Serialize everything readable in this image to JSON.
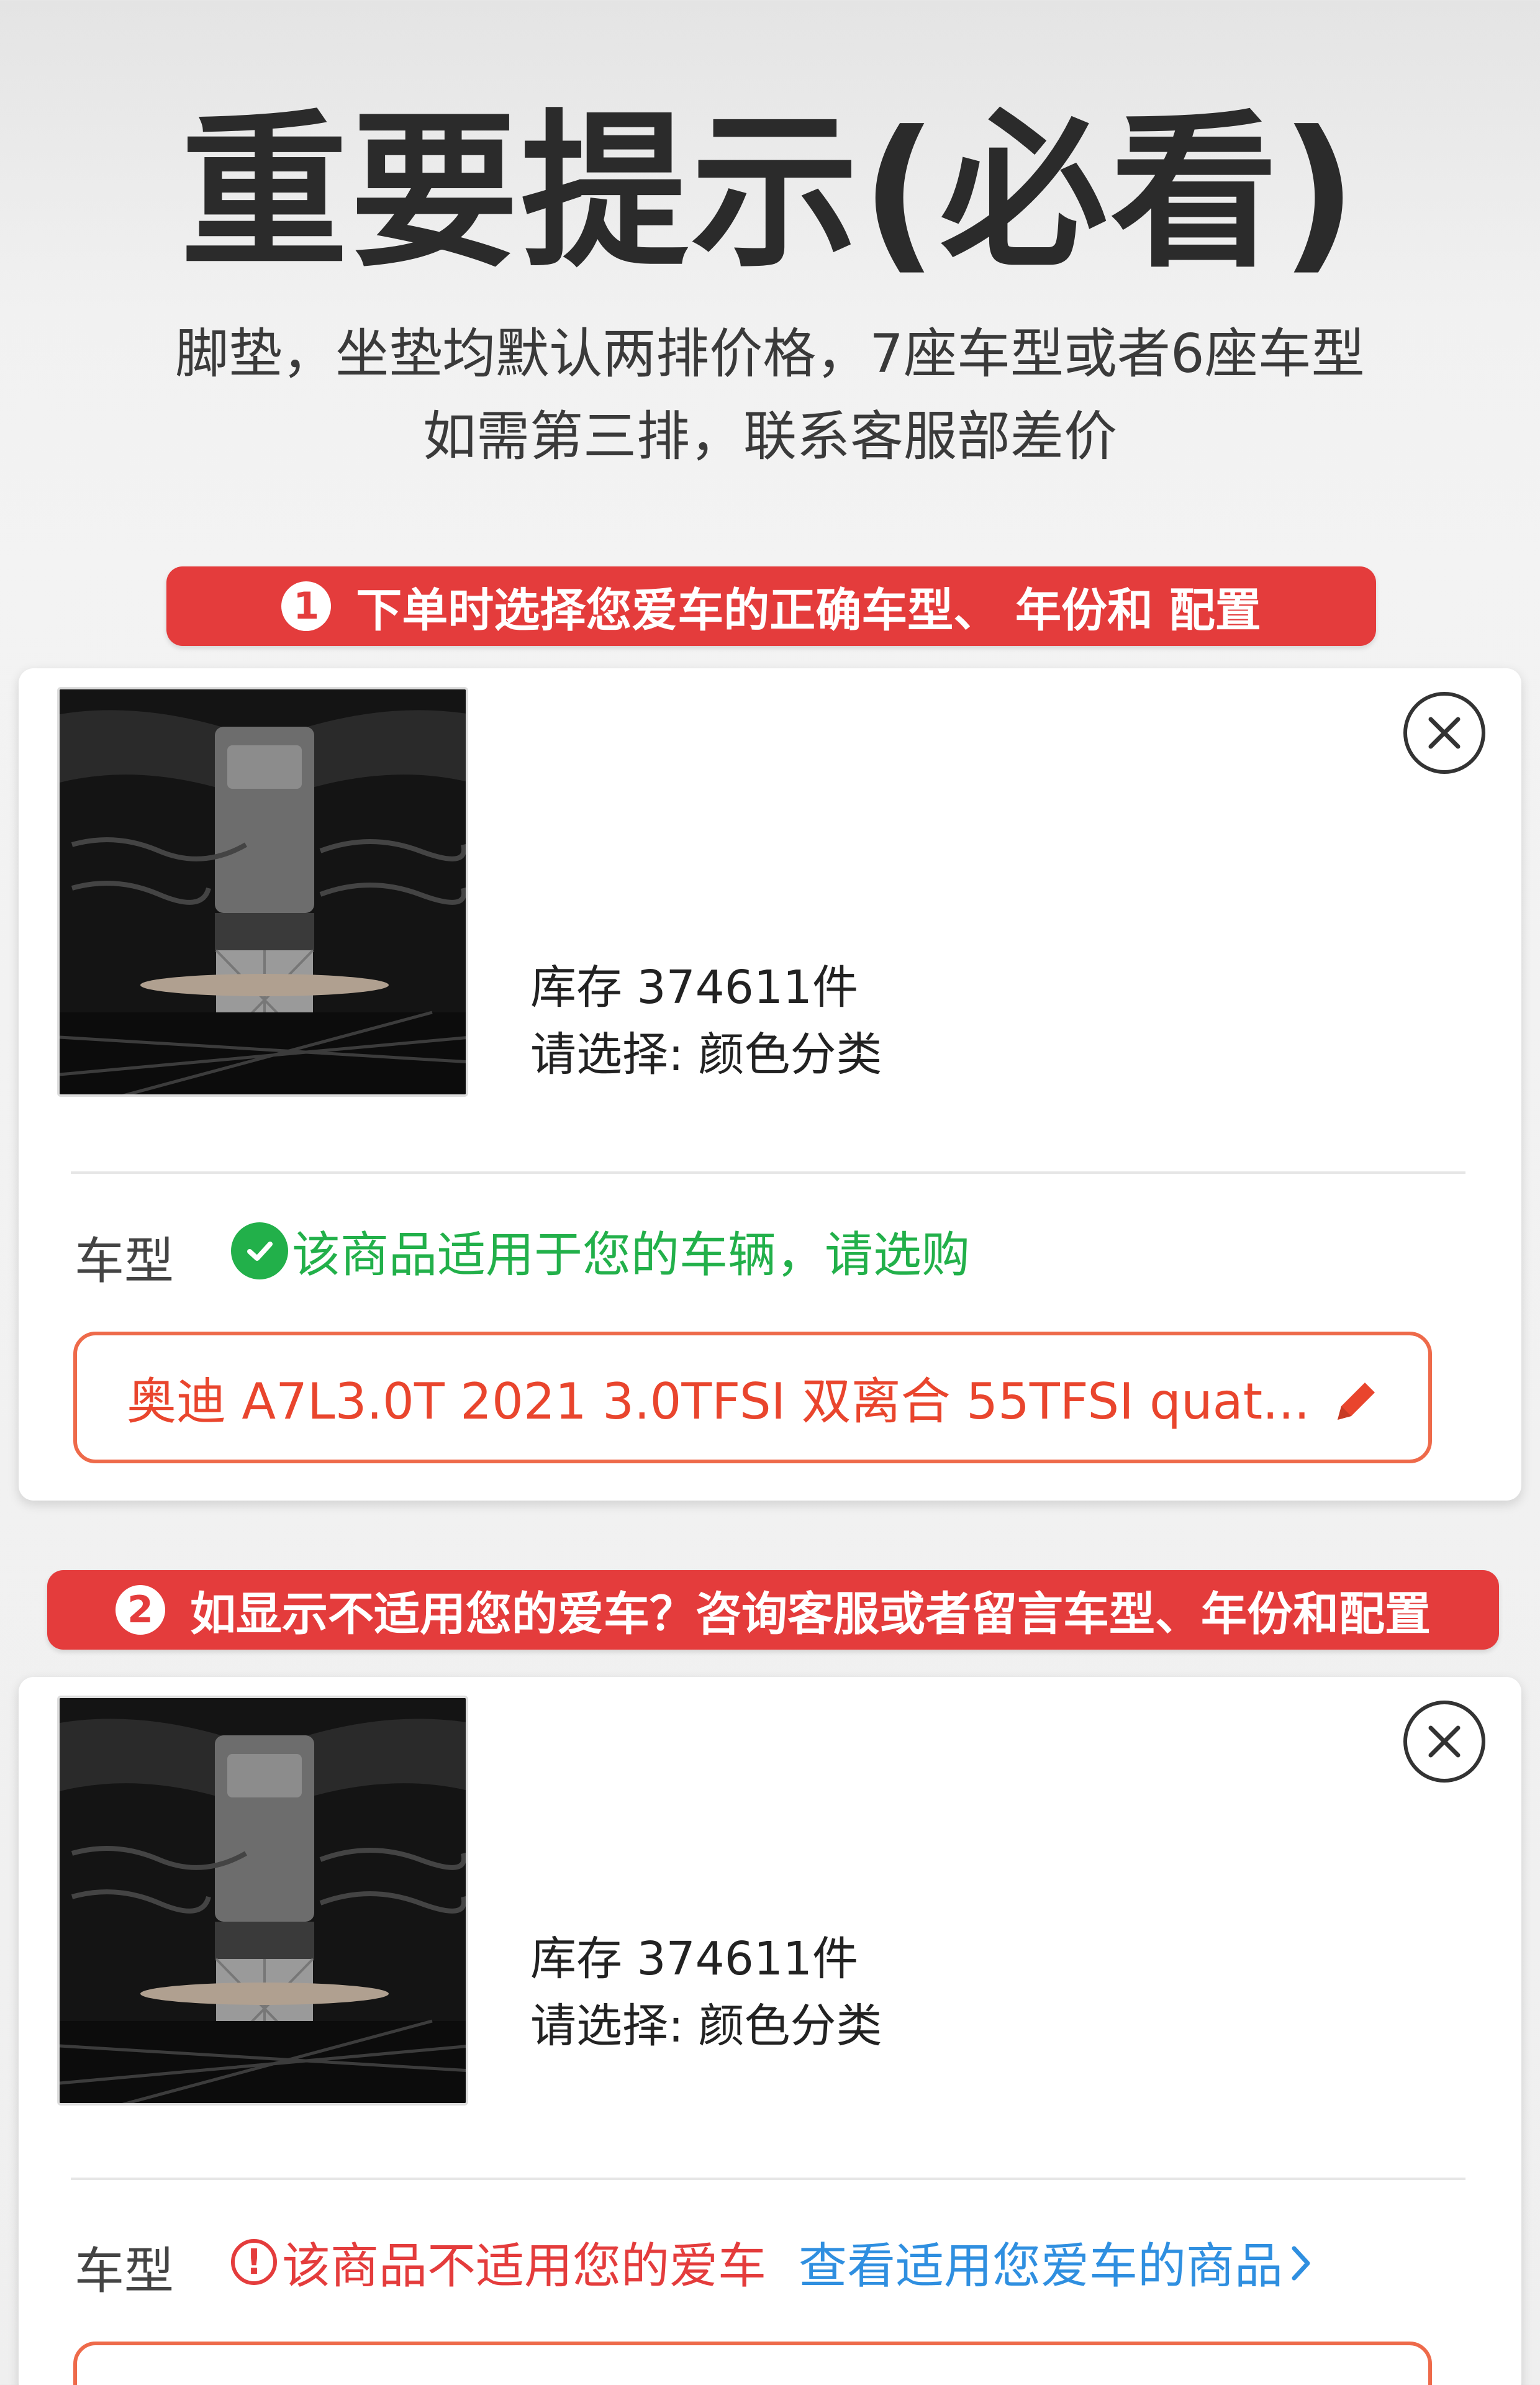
{
  "header": {
    "title": "重要提示(必看)",
    "subtitle_line1": "脚垫，坐垫均默认两排价格，7座车型或者6座车型",
    "subtitle_line2": "如需第三排，联系客服部差价"
  },
  "banner1": {
    "number": "1",
    "text": "下单时选择您爱车的正确车型、 年份和 配置"
  },
  "banner2": {
    "number": "2",
    "text": "如显示不适用您的爱车？咨询客服或者留言车型、年份和配置"
  },
  "card1": {
    "stock": "库存 374611件",
    "select": "请选择: 颜色分类",
    "model_label": "车型",
    "fit_status": "该商品适用于您的车辆，请选购",
    "model_value": "奥迪 A7L3.0T 2021 3.0TFSI 双离合 55TFSI quat..."
  },
  "card2": {
    "stock": "库存 374611件",
    "select": "请选择: 颜色分类",
    "model_label": "车型",
    "fit_status": "该商品不适用您的爱车",
    "link": "查看适用您爱车的商品"
  },
  "colors": {
    "banner_red": "#e43c3c",
    "ok_green": "#22b04a",
    "box_orange": "#ee6a4a",
    "link_blue": "#2f8fe0"
  },
  "icons": [
    "close-icon",
    "check-circle-icon",
    "warning-circle-icon",
    "pencil-icon",
    "chevron-right-icon"
  ]
}
